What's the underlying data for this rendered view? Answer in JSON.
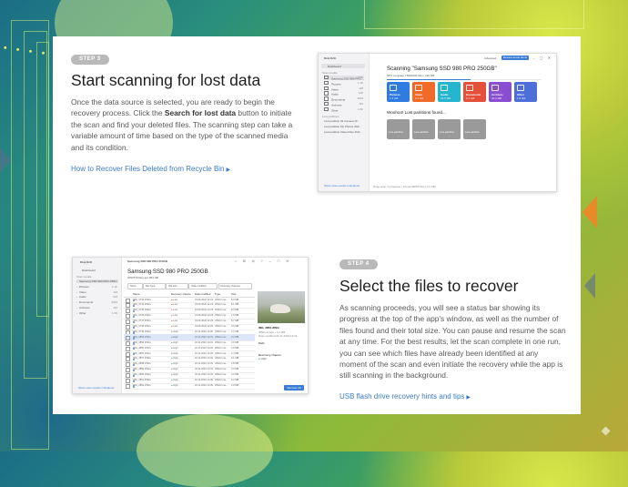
{
  "colors": {
    "accent": "#3a7bc8",
    "badge": "#b9b9b9",
    "heading": "#1e1e1e",
    "body_text": "#5a5a5a"
  },
  "step3": {
    "badge": "STEP 3",
    "title": "Start scanning for lost data",
    "para_pre": "Once the data source is selected, you are ready to begin the recovery process. Click the ",
    "para_bold": "Search for lost data",
    "para_post": " button to initiate the scan and find your deleted files. The scanning step can take a variable amount of time based on the type of the scanned media and its condition.",
    "link": "How to Recover Files Deleted from Recycle Bin",
    "link_icon": "caret-right-icon"
  },
  "step4": {
    "badge": "STEP 4",
    "title": "Select the files to recover",
    "para": "As scanning proceeds, you will see a status bar showing its progress at the top of the app's window, as well as the number of files found and their total size. You can pause and resume the scan at any time. For the best results, let the scan complete in one run, you can see which files have already been identified at any moment of the scan and even initiate the recovery while the app is still scanning in the background.",
    "link": "USB flash drive recovery hints and tips",
    "link_icon": "caret-right-icon"
  },
  "shot1": {
    "app": "Disk Drill",
    "dashboard": "Dashboard",
    "scan_results": "Scan results",
    "side_items": [
      {
        "label": "Samsung SSD 980 PRO...",
        "count": "7.5K"
      },
      {
        "label": "Pictures",
        "count": "1.1K"
      },
      {
        "label": "Video",
        "count": "118"
      },
      {
        "label": "Audio",
        "count": "106"
      },
      {
        "label": "Documents",
        "count": "3019"
      },
      {
        "label": "Archives",
        "count": "116"
      },
      {
        "label": "Other",
        "count": "1.5K"
      }
    ],
    "lost_partitions": "Lost partitions",
    "lost_items": [
      "Lost partition 02 Camera (P...",
      "Lost partition My Photos 4GF...",
      "Lost partition Video Files 4GF..."
    ],
    "show_scan": "Show scan results in Explorer",
    "title": "Scanning \"Samsung SSD 980 PRO 250GB\"",
    "progress": "54% complete • 5064404 files / 722 GB",
    "progress_fraction": 0.54,
    "top_btn_left": "Advanced",
    "top_btn": "Review found items",
    "tiles": [
      {
        "label": "Pictures",
        "size": "1.5 GB",
        "color": "#2f7be0"
      },
      {
        "label": "Video",
        "size": "3.1 GB",
        "color": "#f06a2a"
      },
      {
        "label": "Audio",
        "size": "15.5 MB",
        "color": "#25b5cf"
      },
      {
        "label": "Documents",
        "size": "6.1 GB",
        "color": "#e5503a"
      },
      {
        "label": "Archives",
        "size": "40.2 MB",
        "color": "#8a4fd0"
      },
      {
        "label": "Other",
        "size": "1.8 GB",
        "color": "#4f6fd8"
      }
    ],
    "lost_heading": "Woohoo! Lost partitions found...",
    "gray_tiles": [
      "Lost partition",
      "Lost partition",
      "Lost partition",
      "Lost partition"
    ],
    "status": "Deep scan in progress • Found 35055 files (1.4 GB)"
  },
  "shot2": {
    "app": "Disk Drill",
    "dashboard": "Dashboard",
    "scan_results": "Scan results",
    "side_items": [
      {
        "label": "Samsung SSD 980 PRO 250...",
        "count": "7.5K"
      },
      {
        "label": "Pictures",
        "count": "1.1K"
      },
      {
        "label": "Video",
        "count": "118"
      },
      {
        "label": "Audio",
        "count": "106"
      },
      {
        "label": "Documents",
        "count": "3019"
      },
      {
        "label": "Archives",
        "count": "116"
      },
      {
        "label": "Other",
        "count": "1.5K"
      }
    ],
    "show_scan": "Show scan results in Explorer",
    "breadcrumb": "Samsung SSD 980 PRO 250GB",
    "title": "Samsung SSD 980 PRO 250GB",
    "subtitle": "2097570 files are 954 GB",
    "filters": [
      "Show",
      "File Type",
      "File size",
      "Date modified",
      "Recovery chances"
    ],
    "columns": [
      "Name",
      "Recovery chance",
      "Date modified",
      "Type",
      "Size"
    ],
    "rows": [
      {
        "name": "IMG_0743.JPEG",
        "chance": "Low",
        "date": "19.09.2022 12:24",
        "type": "JPEG Ima...",
        "size": "8.9 MB"
      },
      {
        "name": "IMG_0744.JPEG",
        "chance": "Low",
        "date": "19.09.2022 12:24",
        "type": "JPEG Ima...",
        "size": "8.1 MB"
      },
      {
        "name": "IMG_0745.JPEG",
        "chance": "Low",
        "date": "19.09.2022 12:25",
        "type": "JPEG Ima...",
        "size": "8.3 MB"
      },
      {
        "name": "IMG_0746.JPEG",
        "chance": "Low",
        "date": "19.09.2022 12:25",
        "type": "JPEG Ima...",
        "size": "7.6 MB"
      },
      {
        "name": "IMG_0747.JPEG",
        "chance": "Low",
        "date": "19.09.2022 12:26",
        "type": "JPEG Ima...",
        "size": "8.7 MB"
      },
      {
        "name": "IMG_0748.JPEG",
        "chance": "Low",
        "date": "19.09.2022 12:26",
        "type": "JPEG Ima...",
        "size": "9.0 MB"
      },
      {
        "name": "IMG_0749.JPEG",
        "chance": "High",
        "date": "22.11.2022 14:30",
        "type": "JPEG Ima...",
        "size": "3.2 MB"
      },
      {
        "name": "IMG_2853.JPEG",
        "chance": "High",
        "date": "22.11.2022 14:31",
        "type": "JPEG Ima...",
        "size": "3.2 MB"
      },
      {
        "name": "IMG_2854.JPEG",
        "chance": "High",
        "date": "22.11.2022 14:31",
        "type": "JPEG Ima...",
        "size": "3.0 MB"
      },
      {
        "name": "IMG_2855.JPEG",
        "chance": "High",
        "date": "22.11.2022 14:32",
        "type": "JPEG Ima...",
        "size": "2.9 MB"
      },
      {
        "name": "IMG_2856.JPEG",
        "chance": "High",
        "date": "22.11.2022 14:32",
        "type": "JPEG Ima...",
        "size": "3.4 MB"
      },
      {
        "name": "IMG_2857.JPEG",
        "chance": "High",
        "date": "22.11.2022 14:33",
        "type": "JPEG Ima...",
        "size": "3.1 MB"
      },
      {
        "name": "IMG_2858.JPEG",
        "chance": "High",
        "date": "22.11.2022 14:33",
        "type": "JPEG Ima...",
        "size": "2.8 MB"
      },
      {
        "name": "IMG_2859.JPEG",
        "chance": "High",
        "date": "22.11.2022 14:34",
        "type": "JPEG Ima...",
        "size": "3.3 MB"
      },
      {
        "name": "IMG_2860.JPEG",
        "chance": "High",
        "date": "22.11.2022 14:34",
        "type": "JPEG Ima...",
        "size": "3.0 MB"
      },
      {
        "name": "IMG_2861.JPEG",
        "chance": "High",
        "date": "22.11.2022 14:35",
        "type": "JPEG Ima...",
        "size": "3.2 MB"
      },
      {
        "name": "IMG_2862.JPEG",
        "chance": "High",
        "date": "22.11.2022 14:35",
        "type": "JPEG Ima...",
        "size": "2.9 MB"
      }
    ],
    "selected_row": 7,
    "preview_name": "IMG_2853.JPEG",
    "preview_meta": "JPEG Image • 3.2 MB",
    "preview_date": "Date modified 22.11.2022 14:31",
    "preview_path_label": "Path",
    "preview_chance_label": "Recovery chance",
    "preview_chance": "High",
    "recover_btn": "Recover all"
  }
}
